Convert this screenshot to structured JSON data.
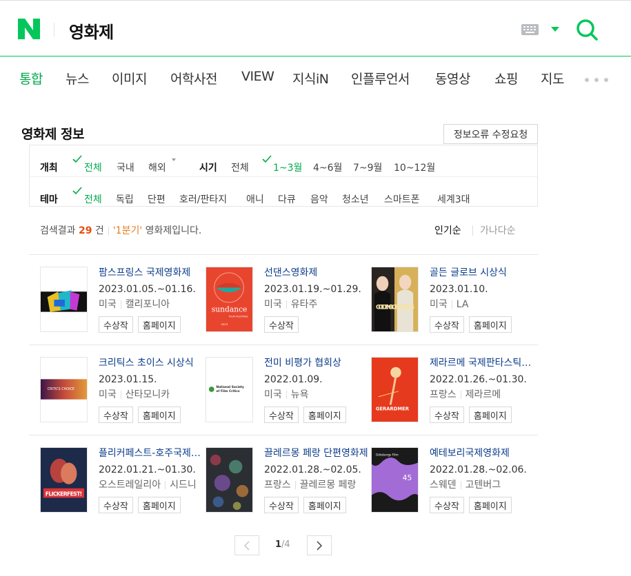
{
  "header": {
    "query": "영화제",
    "brand_color": "#03c75a"
  },
  "tabs": [
    {
      "label": "통합",
      "active": true
    },
    {
      "label": "뉴스"
    },
    {
      "label": "이미지"
    },
    {
      "label": "어학사전"
    },
    {
      "label": "VIEW"
    },
    {
      "label": "지식iN"
    },
    {
      "label": "인플루언서"
    },
    {
      "label": "동영상"
    },
    {
      "label": "쇼핑"
    },
    {
      "label": "지도"
    }
  ],
  "section": {
    "title": "영화제 정보",
    "report_button": "정보오류 수정요청"
  },
  "filters": {
    "venue_label": "개최",
    "venue_options": [
      "전체",
      "국내",
      "해외"
    ],
    "period_label": "시기",
    "period_options": [
      "전체",
      "1~3월",
      "4~6월",
      "7~9월",
      "10~12월"
    ],
    "theme_label": "테마",
    "theme_options": [
      "전체",
      "독립",
      "단편",
      "호러/판타지",
      "애니",
      "다큐",
      "음악",
      "청소년",
      "스마트폰",
      "세계3대"
    ]
  },
  "summary": {
    "prefix": "검색결과",
    "count": "29",
    "unit": "건",
    "quarter": "'1분기'",
    "suffix": "영화제입니다."
  },
  "sort": {
    "popular": "인기순",
    "alphabetical": "가나다순"
  },
  "buttons": {
    "award": "수상작",
    "homepage": "홈페이지"
  },
  "festivals": [
    {
      "name": "팜스프링스 국제영화제",
      "date": "2023.01.05.~01.16.",
      "country": "미국",
      "city": "캘리포니아"
    },
    {
      "name": "선댄스영화제",
      "date": "2023.01.19.~01.29.",
      "country": "미국",
      "city": "유타주"
    },
    {
      "name": "골든 글로브 시상식",
      "date": "2023.01.10.",
      "country": "미국",
      "city": "LA"
    },
    {
      "name": "크리틱스 초이스 시상식",
      "date": "2023.01.15.",
      "country": "미국",
      "city": "산타모니카"
    },
    {
      "name": "전미 비평가 협회상",
      "date": "2022.01.09.",
      "country": "미국",
      "city": "뉴욕"
    },
    {
      "name": "제라르메 국제판타스틱영화제",
      "date": "2022.01.26.~01.30.",
      "country": "프랑스",
      "city": "제라르메"
    },
    {
      "name": "플리커페스트-호주국제단편영화제",
      "date": "2022.01.21.~01.30.",
      "country": "오스트레일리아",
      "city": "시드니"
    },
    {
      "name": "끌레르몽 페랑 단편영화제",
      "date": "2022.01.28.~02.05.",
      "country": "프랑스",
      "city": "끌레르몽 페랑"
    },
    {
      "name": "예테보리국제영화제",
      "date": "2022.01.28.~02.06.",
      "country": "스웨덴",
      "city": "고텐버그"
    }
  ],
  "posters": {
    "sundance_word": "sundance",
    "sundance_sub": "FILM FESTIVAL",
    "sundance_year": "2023",
    "nsfc_line1": "National Society",
    "nsfc_line2": "of Film Critics",
    "golden_globe_text": "GOLDEN GLOBE AWARDS",
    "gerardmer_text": "GERARDMER",
    "flickerfest_text": "FLICKERFEST!",
    "gothenburg_text": "Göteborgs Film",
    "gothenburg_number": "45",
    "critics_choice_text": "CRITICS CHOICE"
  },
  "pager": {
    "current": "1",
    "total": "/4"
  }
}
